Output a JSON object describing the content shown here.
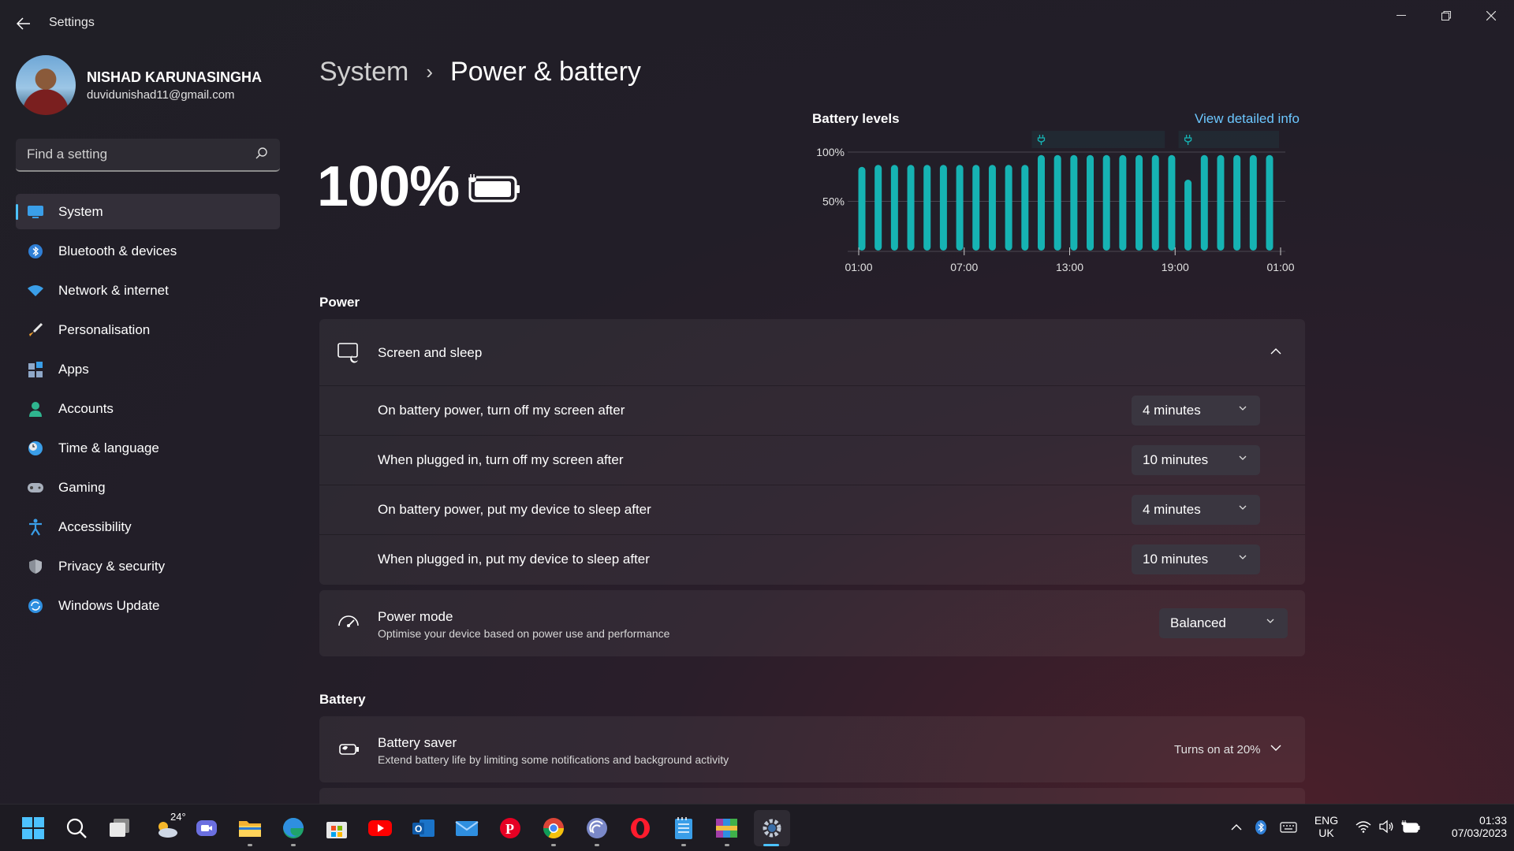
{
  "window": {
    "title": "Settings"
  },
  "profile": {
    "name": "NISHAD KARUNASINGHA",
    "email": "duvidunishad11@gmail.com"
  },
  "search": {
    "placeholder": "Find a setting"
  },
  "sidebar": {
    "items": [
      {
        "label": "System",
        "icon": "system-icon",
        "active": true
      },
      {
        "label": "Bluetooth & devices",
        "icon": "bluetooth-icon"
      },
      {
        "label": "Network & internet",
        "icon": "wifi-icon"
      },
      {
        "label": "Personalisation",
        "icon": "brush-icon"
      },
      {
        "label": "Apps",
        "icon": "apps-icon"
      },
      {
        "label": "Accounts",
        "icon": "accounts-icon"
      },
      {
        "label": "Time & language",
        "icon": "clock-globe-icon"
      },
      {
        "label": "Gaming",
        "icon": "gamepad-icon"
      },
      {
        "label": "Accessibility",
        "icon": "accessibility-icon"
      },
      {
        "label": "Privacy & security",
        "icon": "shield-icon"
      },
      {
        "label": "Windows Update",
        "icon": "update-icon"
      }
    ]
  },
  "breadcrumb": {
    "parent": "System",
    "separator": "›",
    "current": "Power & battery"
  },
  "battery": {
    "percentage": "100%",
    "charging": true
  },
  "chart_data": {
    "type": "bar",
    "title": "Battery levels",
    "link": "View detailed info",
    "y_ticks": [
      "100%",
      "50%"
    ],
    "x_ticks": [
      "01:00",
      "07:00",
      "13:00",
      "19:00",
      "01:00"
    ],
    "ylim": [
      0,
      100
    ],
    "values": [
      85,
      87,
      87,
      87,
      87,
      87,
      87,
      87,
      87,
      87,
      87,
      97,
      97,
      97,
      97,
      97,
      97,
      97,
      97,
      97,
      72,
      97,
      97,
      97,
      97,
      97
    ],
    "plug_markers": [
      11,
      20
    ],
    "color": "#16b3b3"
  },
  "power": {
    "section_title": "Power",
    "screen_sleep": {
      "title": "Screen and sleep",
      "rows": [
        {
          "label": "On battery power, turn off my screen after",
          "value": "4 minutes"
        },
        {
          "label": "When plugged in, turn off my screen after",
          "value": "10 minutes"
        },
        {
          "label": "On battery power, put my device to sleep after",
          "value": "4 minutes"
        },
        {
          "label": "When plugged in, put my device to sleep after",
          "value": "10 minutes"
        }
      ]
    },
    "power_mode": {
      "title": "Power mode",
      "subtitle": "Optimise your device based on power use and performance",
      "value": "Balanced"
    }
  },
  "battery_section": {
    "section_title": "Battery",
    "saver": {
      "title": "Battery saver",
      "subtitle": "Extend battery life by limiting some notifications and background activity",
      "status": "Turns on at 20%"
    }
  },
  "taskbar": {
    "weather_temp": "24°",
    "language": "ENG",
    "region": "UK",
    "time": "01:33",
    "date": "07/03/2023",
    "accent": "#4cc2ff"
  }
}
